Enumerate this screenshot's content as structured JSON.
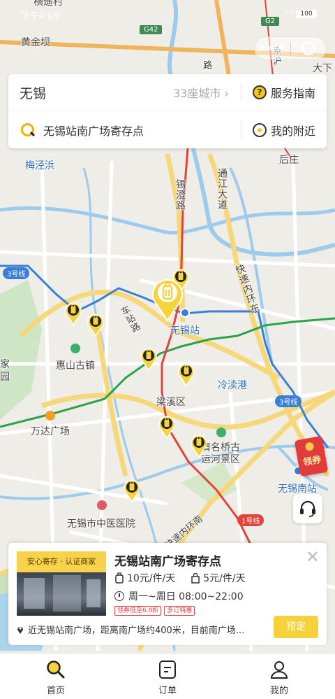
{
  "status_bar": {
    "time": "下午4:09",
    "battery": "100"
  },
  "map": {
    "labels": {
      "huangjinba": "黄金坝",
      "meijingbang": "梅泾浜",
      "houzhuang": "后庄",
      "xichenglu": "锡澄路",
      "tongjiangdadao": "通江大道",
      "kuaisu_neihuan": "快速内环东",
      "wuxi_station": "无锡站",
      "huishan_guzhen": "惠山古镇",
      "liangxi_qu": "梁溪区",
      "lengwaigang": "冷渎港",
      "wanda": "万达广场",
      "qingmingqiao": "清名桥古运河景区",
      "wuxi_south": "无锡南站",
      "zhongyi": "无锡市中医医院",
      "kuaisu_neihuan_nan": "快速内环南",
      "jia": "家",
      "yuan": "园",
      "daxia": "大下",
      "jingyu": "京沪",
      "qiaotou": "横遥村",
      "chelu": "车站路",
      "lu_label": "路"
    },
    "line_badges": {
      "line3_left": "3号线",
      "line3_right": "3号线",
      "line1": "1号线",
      "g42": "G42",
      "g2": "G2"
    }
  },
  "search": {
    "city": "无锡",
    "city_count": "33座城市",
    "guide": "服务指南",
    "query": "无锡站南广场寄存点",
    "nearby": "我的附近"
  },
  "coupon": {
    "label": "领券"
  },
  "store": {
    "thumb_tag": "安心寄存 · 认证商家",
    "name": "无锡站南广场寄存点",
    "price_large": "10元/件/天",
    "price_small": "5元/件/天",
    "hours": "周一~周日 08:00~22:00",
    "promo1": "领券低至6.8折",
    "promo2": "多订特惠",
    "address": "近无锡站南广场，距离南广场约400米，目前南广场...",
    "reserve": "预定"
  },
  "tabs": {
    "home": "首页",
    "orders": "订单",
    "mine": "我的"
  },
  "colors": {
    "accent": "#f5d23a",
    "rail_red": "#e0443a",
    "metro_blue": "#3a7fd6",
    "metro_green": "#2ca24a"
  }
}
